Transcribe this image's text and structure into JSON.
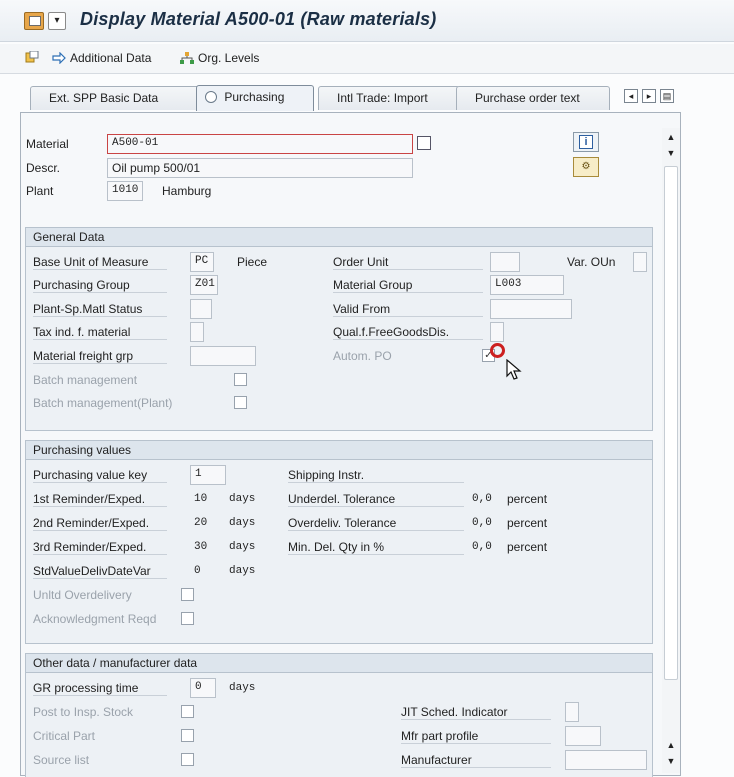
{
  "window": {
    "title": "Display Material A500-01 (Raw materials)"
  },
  "toolbar": {
    "additional_data": "Additional Data",
    "org_levels": "Org. Levels"
  },
  "tabs": [
    {
      "label": "Ext. SPP Basic Data"
    },
    {
      "label": "Purchasing"
    },
    {
      "label": "Intl Trade: Import"
    },
    {
      "label": "Purchase order text"
    }
  ],
  "header": {
    "material_label": "Material",
    "material_value": "A500-01",
    "descr_label": "Descr.",
    "descr_value": "Oil pump 500/01",
    "plant_label": "Plant",
    "plant_value": "1010",
    "plant_name": "Hamburg"
  },
  "general_data": {
    "title": "General Data",
    "base_uom_label": "Base Unit of Measure",
    "base_uom_value": "PC",
    "base_uom_text": "Piece",
    "order_unit_label": "Order Unit",
    "order_unit_value": "",
    "var_oun_label": "Var. OUn",
    "purch_group_label": "Purchasing Group",
    "purch_group_value": "Z01",
    "material_group_label": "Material Group",
    "material_group_value": "L003",
    "plant_sp_status_label": "Plant-Sp.Matl Status",
    "plant_sp_status_value": "",
    "valid_from_label": "Valid From",
    "valid_from_value": "",
    "tax_ind_label": "Tax ind. f. material",
    "tax_ind_value": "",
    "qual_free_goods_label": "Qual.f.FreeGoodsDis.",
    "qual_free_goods_value": "",
    "freight_grp_label": "Material freight grp",
    "freight_grp_value": "",
    "autom_po_label": "Autom. PO",
    "autom_po_checked": true,
    "batch_mgmt_label": "Batch management",
    "batch_mgmt_checked": false,
    "batch_mgmt_plant_label": "Batch management(Plant)",
    "batch_mgmt_plant_checked": false
  },
  "purchasing_values": {
    "title": "Purchasing values",
    "value_key_label": "Purchasing value key",
    "value_key_value": "1",
    "shipping_instr_label": "Shipping Instr.",
    "r1_label": "1st Reminder/Exped.",
    "r1_value": "10",
    "r1_unit": "days",
    "underdel_label": "Underdel. Tolerance",
    "underdel_value": "0,0",
    "underdel_unit": "percent",
    "r2_label": "2nd Reminder/Exped.",
    "r2_value": "20",
    "r2_unit": "days",
    "overdel_label": "Overdeliv. Tolerance",
    "overdel_value": "0,0",
    "overdel_unit": "percent",
    "r3_label": "3rd Reminder/Exped.",
    "r3_value": "30",
    "r3_unit": "days",
    "min_del_label": "Min. Del. Qty in %",
    "min_del_value": "0,0",
    "min_del_unit": "percent",
    "std_value_label": "StdValueDelivDateVar",
    "std_value_value": "0",
    "std_value_unit": "days",
    "unltd_label": "Unltd Overdelivery",
    "ack_label": "Acknowledgment Reqd"
  },
  "other_data": {
    "title": "Other data / manufacturer data",
    "gr_time_label": "GR processing time",
    "gr_time_value": "0",
    "gr_time_unit": "days",
    "post_insp_label": "Post to Insp. Stock",
    "jit_label": "JIT Sched. Indicator",
    "critical_label": "Critical Part",
    "mfr_profile_label": "Mfr part profile",
    "source_list_label": "Source list",
    "manufacturer_label": "Manufacturer"
  },
  "icons": {
    "info": "info-icon",
    "hierarchy": "hierarchy-icon",
    "edit_arrow": "arrow-icon"
  },
  "colors": {
    "title": "#1b2f45",
    "group_header": "#dde5ed",
    "cursor_ring": "#cc1f1f"
  }
}
